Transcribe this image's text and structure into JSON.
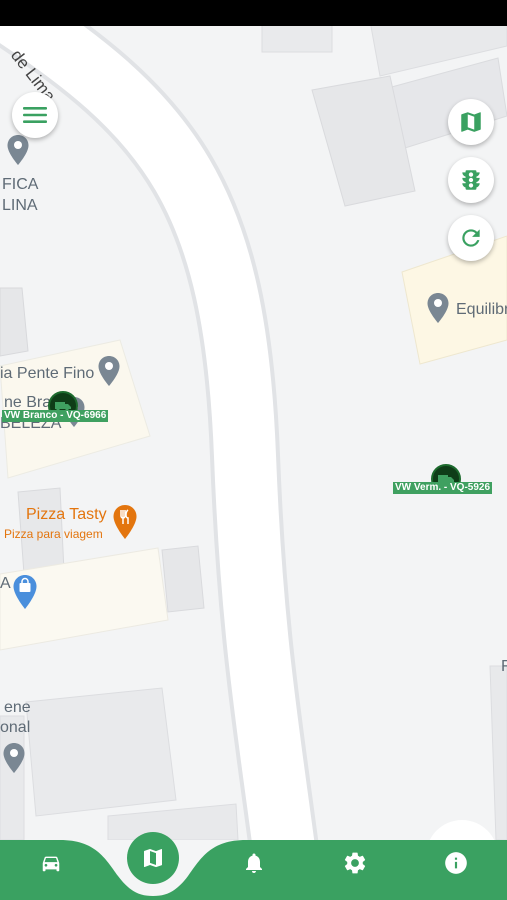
{
  "map": {
    "street_label": "de Lima",
    "labels": {
      "top_left_line1": "FICA",
      "top_left_line2": "LINA",
      "pente_fino": "ia Pente Fino",
      "beleza_line1": "ne Bra",
      "beleza_line2": "BELEZA",
      "equilibrio": "Equilibri",
      "pizza_title": "Pizza Tasty",
      "pizza_subtitle": "Pizza para viagem",
      "left_mid": "A",
      "bottom_left_line1": "ene",
      "bottom_left_line2": "onal",
      "right_edge": "F"
    },
    "vehicles": [
      {
        "plate": "VW Branco - VQ-6966"
      },
      {
        "plate": "VW Verm. - VQ-5926"
      }
    ]
  },
  "colors": {
    "brand_green": "#3aa161",
    "plate_green": "#3fa060",
    "vehicle_marker": "#0f3d18",
    "poi_gray": "#7a8793",
    "food_orange": "#e3750e",
    "shop_blue": "#4a8fdc"
  },
  "controls": {
    "menu": "menu-icon",
    "map_layers": "map-icon",
    "traffic": "traffic-light-icon",
    "refresh": "refresh-icon"
  },
  "bottom_nav": {
    "items": [
      "car-icon",
      "map-icon",
      "bell-icon",
      "gear-icon",
      "info-icon"
    ],
    "active": "map-icon"
  }
}
